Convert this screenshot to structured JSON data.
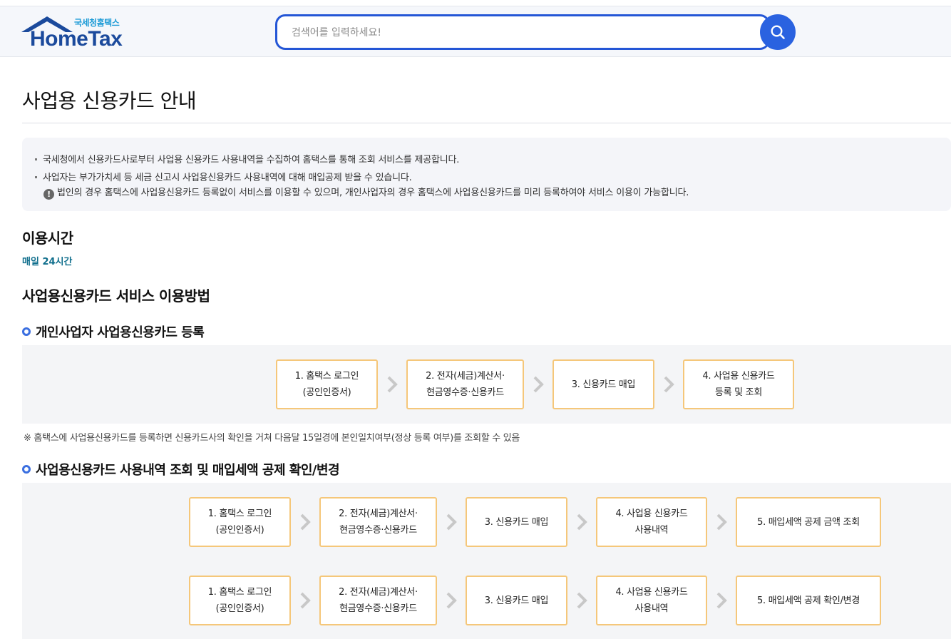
{
  "header": {
    "logo_subtitle": "국세청홈택스",
    "logo_text": "HomeTax",
    "search_placeholder": "검색어를 입력하세요!"
  },
  "page": {
    "title": "사업용 신용카드 안내"
  },
  "info": {
    "line1": "국세청에서 신용카드사로부터 사업용 신용카드 사용내역을 수집하여 홈택스를 통해 조회 서비스를 제공합니다.",
    "line2": "사업자는 부가가치세 등 세금 신고시 사업용신용카드 사용내역에 대해 매입공제 받을 수 있습니다.",
    "notice": "법인의 경우 홈택스에 사업용신용카드 등록없이 서비스를 이용할 수 있으며, 개인사업자의 경우 홈택스에 사업용신용카드를 미리 등록하여야 서비스 이용이 가능합니다."
  },
  "usage_time": {
    "heading": "이용시간",
    "value": "매일 24시간"
  },
  "how_to": {
    "heading": "사업용신용카드 서비스 이용방법"
  },
  "register": {
    "heading": "개인사업자 사업용신용카드 등록",
    "steps": [
      {
        "line1": "1. 홈택스 로그인",
        "line2": "(공인인증서)"
      },
      {
        "line1": "2. 전자(세금)계산서·",
        "line2": "현금영수증·신용카드"
      },
      {
        "line1": "3. 신용카드 매입",
        "line2": ""
      },
      {
        "line1": "4. 사업용 신용카드",
        "line2": "등록 및 조회"
      }
    ],
    "footnote": "※ 홈택스에 사업용신용카드를 등록하면 신용카드사의 확인을 거쳐 다음달 15일경에 본인일치여부(정상 등록 여부)를 조회할 수 있음"
  },
  "inquiry": {
    "heading": "사업용신용카드 사용내역 조회 및 매입세액 공제 확인/변경",
    "row1": [
      {
        "line1": "1. 홈택스 로그인",
        "line2": "(공인인증서)"
      },
      {
        "line1": "2. 전자(세금)계산서·",
        "line2": "현금영수증·신용카드"
      },
      {
        "line1": "3. 신용카드 매입",
        "line2": ""
      },
      {
        "line1": "4. 사업용 신용카드",
        "line2": "사용내역"
      },
      {
        "line1": "5. 매입세액 공제 금액 조회",
        "line2": ""
      }
    ],
    "row2": [
      {
        "line1": "1. 홈택스 로그인",
        "line2": "(공인인증서)"
      },
      {
        "line1": "2. 전자(세금)계산서·",
        "line2": "현금영수증·신용카드"
      },
      {
        "line1": "3. 신용카드 매입",
        "line2": ""
      },
      {
        "line1": "4. 사업용 신용카드",
        "line2": "사용내역"
      },
      {
        "line1": "5. 매입세액 공제 확인/변경",
        "line2": ""
      }
    ]
  },
  "icons": {
    "search": "search-icon",
    "arrow": "chevron-right-icon",
    "notice": "exclamation-icon"
  },
  "colors": {
    "brand_blue": "#1b4a9c",
    "search_accent": "#2a62e0",
    "step_border": "#f5c77a",
    "hours_text": "#0f6e8c"
  }
}
